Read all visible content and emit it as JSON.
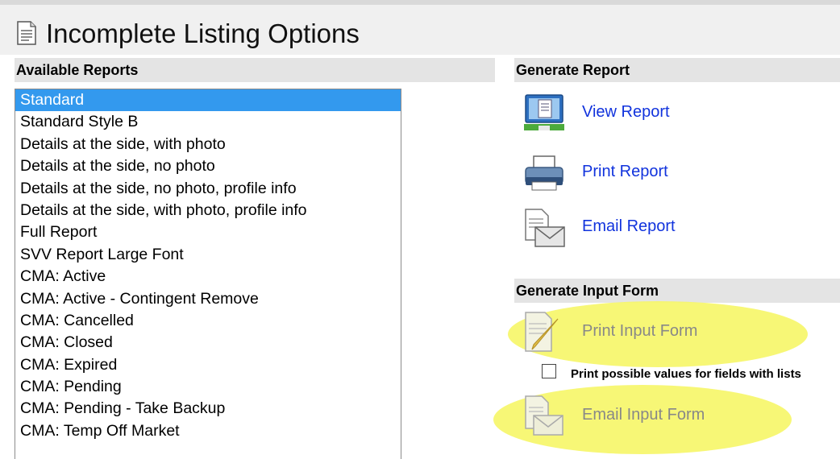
{
  "title": "Incomplete Listing Options",
  "available_reports": {
    "header": "Available Reports",
    "items": [
      "Standard",
      "Standard Style B",
      "Details at the side, with photo",
      "Details at the side, no photo",
      "Details at the side, no photo, profile info",
      "Details at the side, with photo, profile info",
      "Full Report",
      "SVV Report Large Font",
      "CMA: Active",
      "CMA: Active - Contingent Remove",
      "CMA: Cancelled",
      "CMA: Closed",
      "CMA: Expired",
      "CMA: Pending",
      "CMA: Pending - Take Backup",
      "CMA: Temp Off Market"
    ],
    "selected": "Standard"
  },
  "generate_report": {
    "header": "Generate Report",
    "view_label": "View Report",
    "print_label": "Print Report",
    "email_label": "Email Report"
  },
  "generate_input_form": {
    "header": "Generate Input Form",
    "print_label": "Print Input Form",
    "checkbox_label": "Print possible values for fields with lists",
    "checkbox_checked": false,
    "email_label": "Email Input Form"
  },
  "colors": {
    "link": "#1133dd",
    "disabled": "#888888",
    "selection": "#3399ee",
    "highlight": "#f6f66a"
  }
}
